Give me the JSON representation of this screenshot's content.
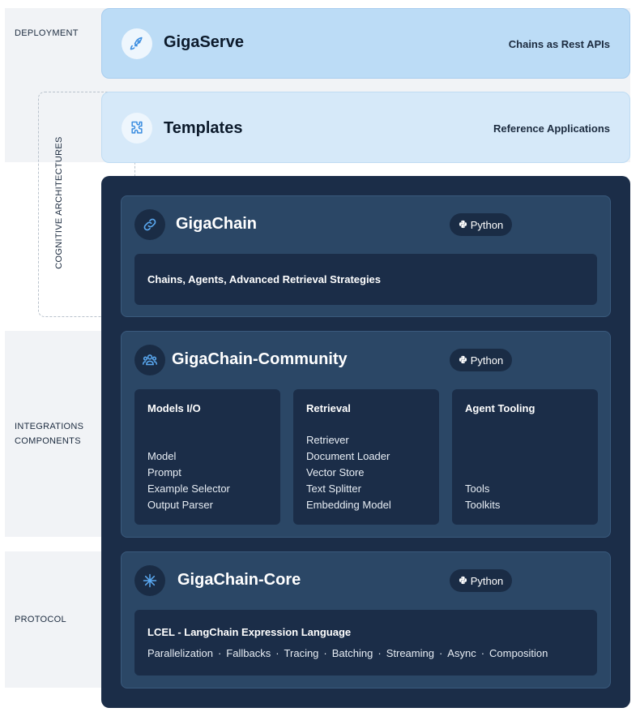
{
  "layers": [
    {
      "label": "DEPLOYMENT"
    },
    {
      "label": "COGNITIVE ARCHITECTURES"
    },
    {
      "label": "INTEGRATIONS\nCOMPONENTS"
    },
    {
      "label": "PROTOCOL"
    }
  ],
  "gigaserve": {
    "title": "GigaServe",
    "subtitle": "Chains as Rest APIs",
    "icon": "rocket-icon"
  },
  "templates": {
    "title": "Templates",
    "subtitle": "Reference Applications",
    "icon": "puzzle-icon"
  },
  "gigachain": {
    "title": "GigaChain",
    "badge": "Python",
    "icon": "link-icon",
    "description": "Chains, Agents, Advanced Retrieval Strategies"
  },
  "community": {
    "title": "GigaChain-Community",
    "badge": "Python",
    "icon": "users-icon",
    "columns": [
      {
        "heading": "Models I/O",
        "items": [
          "Model",
          "Prompt",
          "Example Selector",
          "Output Parser"
        ]
      },
      {
        "heading": "Retrieval",
        "items": [
          "Retriever",
          "Document Loader",
          "Vector Store",
          "Text Splitter",
          "Embedding Model"
        ]
      },
      {
        "heading": "Agent Tooling",
        "items": [
          "Tools",
          "Toolkits"
        ]
      }
    ]
  },
  "core": {
    "title": "GigaChain-Core",
    "badge": "Python",
    "icon": "asterisk-icon",
    "lcel_title": "LCEL - LangChain Expression Language",
    "features": [
      "Parallelization",
      "Fallbacks",
      "Tracing",
      "Batching",
      "Streaming",
      "Async",
      "Composition"
    ],
    "separator": "·"
  },
  "colors": {
    "light_blue": "#bcdcf6",
    "pale_blue": "#d6e9f9",
    "navy": "#1b2d48",
    "panel": "#2b4766",
    "icon_accent": "#5aa8f0"
  }
}
